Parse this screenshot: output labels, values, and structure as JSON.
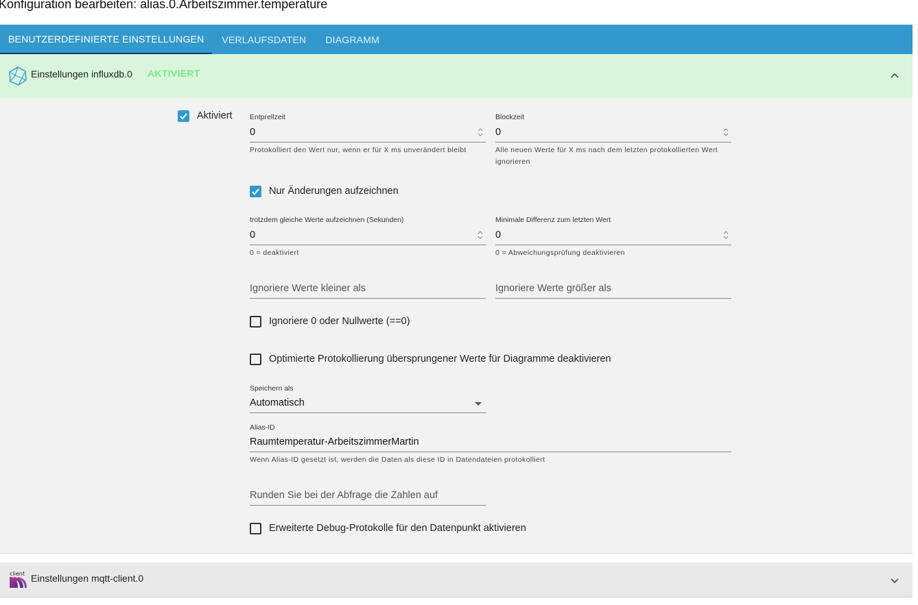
{
  "window": {
    "title": "Konfiguration bearbeiten: alias.0.Arbeitszimmer.temperature"
  },
  "tabs": [
    {
      "label": "BENUTZERDEFINIERTE EINSTELLUNGEN",
      "active": true
    },
    {
      "label": "VERLAUFSDATEN",
      "active": false
    },
    {
      "label": "DIAGRAMM",
      "active": false
    }
  ],
  "panel_influx": {
    "title": "Einstellungen influxdb.0",
    "status": "AKTIVIERT",
    "enabled_label": "Aktiviert",
    "debounce": {
      "label": "Entprellzeit",
      "value": "0",
      "help": "Protokolliert den Wert nur, wenn er für X ms unverändert bleibt"
    },
    "blocktime": {
      "label": "Blockzeit",
      "value": "0",
      "help": "Alle neuen Werte für X ms nach dem letzten protokollierten Wert ignorieren"
    },
    "changes_only_label": "Nur Änderungen aufzeichnen",
    "same_values": {
      "label": "trotzdem gleiche Werte aufzeichnen (Sekunden)",
      "value": "0",
      "help": "0 = deaktiviert"
    },
    "min_diff": {
      "label": "Minimale Differenz zum letzten Wert",
      "value": "0",
      "help": "0 = Abweichungsprüfung deaktivieren"
    },
    "ignore_below_placeholder": "Ignoriere Werte kleiner als",
    "ignore_above_placeholder": "Ignoriere Werte größer als",
    "ignore_zero_label": "Ignoriere 0 oder Nullwerte (==0)",
    "disable_skipped_label": "Optimierte Protokollierung übersprungener Werte für Diagramme deaktivieren",
    "store_as": {
      "label": "Speichern als",
      "value": "Automatisch"
    },
    "alias_id": {
      "label": "Alias-ID",
      "value": "Raumtemperatur-ArbeitszimmerMartin",
      "help": "Wenn Alias-ID gesetzt ist, werden die Daten als diese ID in Datendateien protokolliert"
    },
    "round_placeholder": "Runden Sie bei der Abfrage die Zahlen auf",
    "debug_label": "Erweiterte Debug-Protokolle für den Datenpunkt aktivieren"
  },
  "panel_mqtt": {
    "title": "Einstellungen mqtt-client.0",
    "logo_text": "client"
  },
  "colors": {
    "tab_bar": "#3399cc",
    "panel_active": "#d9f5dc",
    "status": "#7de88b",
    "checkbox": "#3399cc"
  }
}
